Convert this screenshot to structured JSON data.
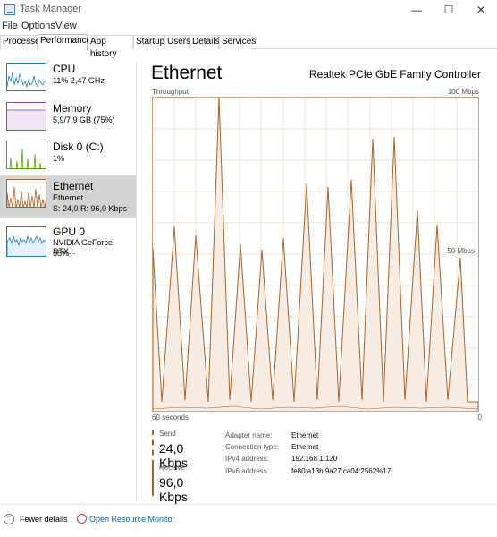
{
  "window": {
    "title": "Task Manager",
    "min": "—",
    "max": "☐",
    "close": "✕"
  },
  "menu": [
    "File",
    "Options",
    "View"
  ],
  "tabs": [
    "Processes",
    "Performance",
    "App history",
    "Startup",
    "Users",
    "Details",
    "Services"
  ],
  "active_tab": "Performance",
  "sidebar": [
    {
      "name": "CPU",
      "lines": [
        "11%  2,47 GHz"
      ],
      "color": "#1c7fc1",
      "fill": "#e5f0fb",
      "selected": false
    },
    {
      "name": "Memory",
      "lines": [
        "5,9/7,9 GB (75%)"
      ],
      "color": "#9b3fb5",
      "fill": "#f1e3f6",
      "selected": false
    },
    {
      "name": "Disk 0 (C:)",
      "lines": [
        "1%"
      ],
      "color": "#4da60c",
      "fill": "#eff8e6",
      "selected": false
    },
    {
      "name": "Ethernet",
      "lines": [
        "Ethernet",
        "S: 24,0  R: 96,0 Kbps"
      ],
      "color": "#a7642b",
      "fill": "#f6ece3",
      "selected": true
    },
    {
      "name": "GPU 0",
      "lines": [
        "NVIDIA GeForce RTX...",
        "55%"
      ],
      "color": "#1c7fc1",
      "fill": "#e5f0fb",
      "selected": false
    }
  ],
  "main": {
    "title": "Ethernet",
    "adapter": "Realtek PCIe GbE Family Controller",
    "throughput_label": "Throughput",
    "max_label": "100 Mbps",
    "mid_label": "50 Mbps",
    "time_label": "60 seconds",
    "zero_label": "0",
    "send_label": "Send",
    "send_value": "24,0 Kbps",
    "receive_label": "Receive",
    "receive_value": "96,0 Kbps",
    "details": [
      {
        "label": "Adapter name:",
        "value": "Ethernet"
      },
      {
        "label": "Connection type:",
        "value": "Ethernet"
      },
      {
        "label": "IPv4 address:",
        "value": "192.168.1.120"
      },
      {
        "label": "IPv6 address:",
        "value": "fe80:a13b:9a27:ca04:2562%17"
      }
    ]
  },
  "footer": {
    "fewer": "Fewer details",
    "monitor": "Open Resource Monitor"
  },
  "colors": {
    "eth_line": "#a7642b",
    "eth_fill": "#f6ece3",
    "grid": "#f0e3d6",
    "link": "#1a5fb4"
  }
}
